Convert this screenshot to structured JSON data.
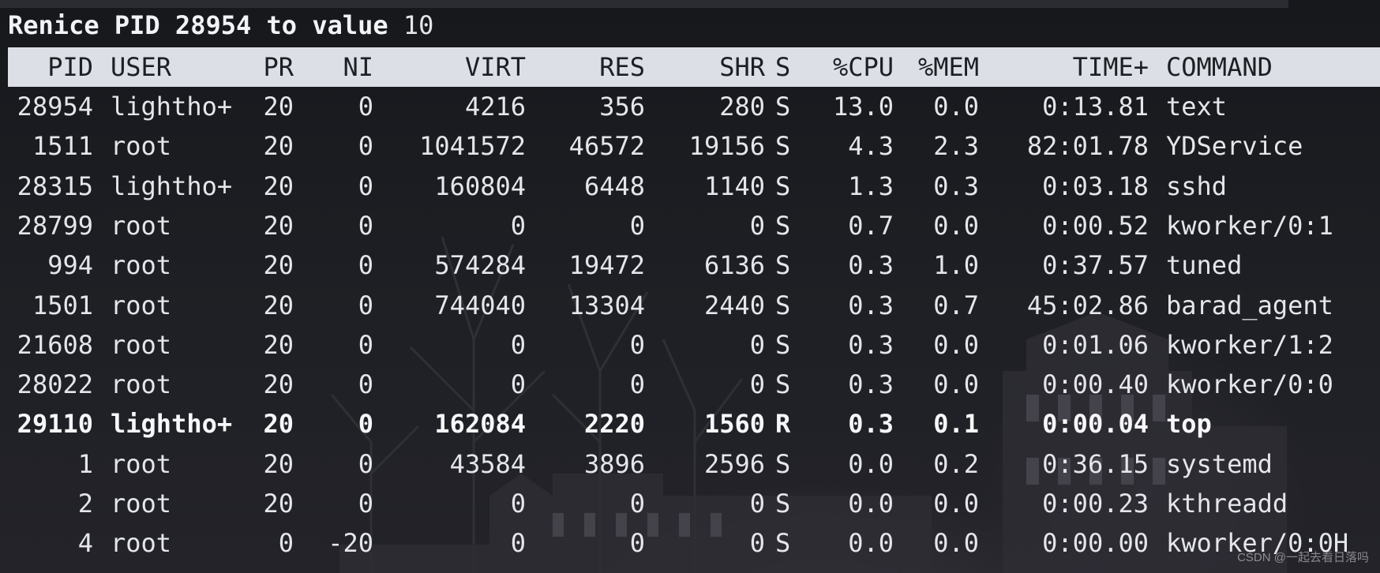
{
  "prompt": {
    "text": "Renice PID 28954 to value",
    "value": "10"
  },
  "table": {
    "columns": [
      "PID",
      "USER",
      "PR",
      "NI",
      "VIRT",
      "RES",
      "SHR",
      "S",
      "%CPU",
      "%MEM",
      "TIME+",
      "COMMAND"
    ],
    "rows": [
      {
        "pid": "28954",
        "user": "lightho+",
        "pr": "20",
        "ni": "0",
        "virt": "4216",
        "res": "356",
        "shr": "280",
        "s": "S",
        "cpu": "13.0",
        "mem": "0.0",
        "time": "0:13.81",
        "command": "text",
        "bold": false
      },
      {
        "pid": "1511",
        "user": "root",
        "pr": "20",
        "ni": "0",
        "virt": "1041572",
        "res": "46572",
        "shr": "19156",
        "s": "S",
        "cpu": "4.3",
        "mem": "2.3",
        "time": "82:01.78",
        "command": "YDService",
        "bold": false
      },
      {
        "pid": "28315",
        "user": "lightho+",
        "pr": "20",
        "ni": "0",
        "virt": "160804",
        "res": "6448",
        "shr": "1140",
        "s": "S",
        "cpu": "1.3",
        "mem": "0.3",
        "time": "0:03.18",
        "command": "sshd",
        "bold": false
      },
      {
        "pid": "28799",
        "user": "root",
        "pr": "20",
        "ni": "0",
        "virt": "0",
        "res": "0",
        "shr": "0",
        "s": "S",
        "cpu": "0.7",
        "mem": "0.0",
        "time": "0:00.52",
        "command": "kworker/0:1",
        "bold": false
      },
      {
        "pid": "994",
        "user": "root",
        "pr": "20",
        "ni": "0",
        "virt": "574284",
        "res": "19472",
        "shr": "6136",
        "s": "S",
        "cpu": "0.3",
        "mem": "1.0",
        "time": "0:37.57",
        "command": "tuned",
        "bold": false
      },
      {
        "pid": "1501",
        "user": "root",
        "pr": "20",
        "ni": "0",
        "virt": "744040",
        "res": "13304",
        "shr": "2440",
        "s": "S",
        "cpu": "0.3",
        "mem": "0.7",
        "time": "45:02.86",
        "command": "barad_agent",
        "bold": false
      },
      {
        "pid": "21608",
        "user": "root",
        "pr": "20",
        "ni": "0",
        "virt": "0",
        "res": "0",
        "shr": "0",
        "s": "S",
        "cpu": "0.3",
        "mem": "0.0",
        "time": "0:01.06",
        "command": "kworker/1:2",
        "bold": false
      },
      {
        "pid": "28022",
        "user": "root",
        "pr": "20",
        "ni": "0",
        "virt": "0",
        "res": "0",
        "shr": "0",
        "s": "S",
        "cpu": "0.3",
        "mem": "0.0",
        "time": "0:00.40",
        "command": "kworker/0:0",
        "bold": false
      },
      {
        "pid": "29110",
        "user": "lightho+",
        "pr": "20",
        "ni": "0",
        "virt": "162084",
        "res": "2220",
        "shr": "1560",
        "s": "R",
        "cpu": "0.3",
        "mem": "0.1",
        "time": "0:00.04",
        "command": "top",
        "bold": true
      },
      {
        "pid": "1",
        "user": "root",
        "pr": "20",
        "ni": "0",
        "virt": "43584",
        "res": "3896",
        "shr": "2596",
        "s": "S",
        "cpu": "0.0",
        "mem": "0.2",
        "time": "0:36.15",
        "command": "systemd",
        "bold": false
      },
      {
        "pid": "2",
        "user": "root",
        "pr": "20",
        "ni": "0",
        "virt": "0",
        "res": "0",
        "shr": "0",
        "s": "S",
        "cpu": "0.0",
        "mem": "0.0",
        "time": "0:00.23",
        "command": "kthreadd",
        "bold": false
      },
      {
        "pid": "4",
        "user": "root",
        "pr": "0",
        "ni": "-20",
        "virt": "0",
        "res": "0",
        "shr": "0",
        "s": "S",
        "cpu": "0.0",
        "mem": "0.0",
        "time": "0:00.00",
        "command": "kworker/0:0H",
        "bold": false
      }
    ]
  },
  "watermark": "CSDN @一起去看日落吗",
  "colors": {
    "background": "#1b1d22",
    "header_bar": "#dcdfe5",
    "text": "#e4e6ea",
    "header_text": "#1d1f24"
  }
}
